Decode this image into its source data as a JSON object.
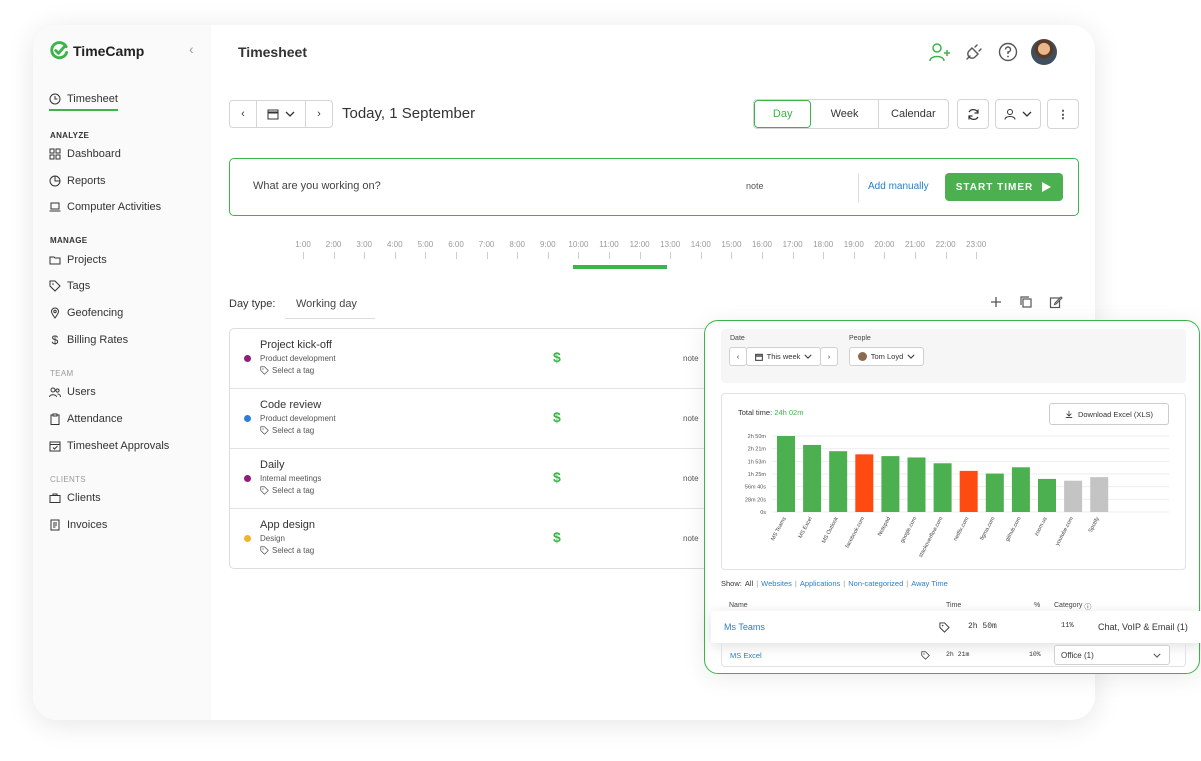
{
  "app": {
    "name": "TimeCamp",
    "page_title": "Timesheet"
  },
  "sidebar": {
    "timesheet": "Timesheet",
    "sections": {
      "analyze": "ANALYZE",
      "manage": "MANAGE",
      "team": "TEAM",
      "clients": "CLIENTS"
    },
    "items": {
      "dashboard": "Dashboard",
      "reports": "Reports",
      "computer_activities": "Computer Activities",
      "projects": "Projects",
      "tags": "Tags",
      "geofencing": "Geofencing",
      "billing_rates": "Billing Rates",
      "users": "Users",
      "attendance": "Attendance",
      "timesheet_approvals": "Timesheet Approvals",
      "clients": "Clients",
      "invoices": "Invoices"
    }
  },
  "toolbar": {
    "date_label": "Today, 1 September",
    "views": [
      "Day",
      "Week",
      "Calendar"
    ],
    "selected_view": "Day"
  },
  "timer": {
    "placeholder": "What are you working on?",
    "note": "note",
    "add_manually": "Add manually",
    "start": "START TIMER"
  },
  "hours": [
    "1:00",
    "2:00",
    "3:00",
    "4:00",
    "5:00",
    "6:00",
    "7:00",
    "8:00",
    "9:00",
    "10:00",
    "11:00",
    "12:00",
    "13:00",
    "14:00",
    "15:00",
    "16:00",
    "17:00",
    "18:00",
    "19:00",
    "20:00",
    "21:00",
    "22:00",
    "23:00"
  ],
  "day_type": {
    "label": "Day type:",
    "value": "Working day"
  },
  "entries": [
    {
      "name": "Project kick-off",
      "project": "Product development",
      "tag": "Select a tag",
      "note": "note",
      "color": "#8e1e7a"
    },
    {
      "name": "Code review",
      "project": "Product development",
      "tag": "Select a tag",
      "note": "note",
      "color": "#2d7fd3"
    },
    {
      "name": "Daily",
      "project": "Internal meetings",
      "tag": "Select a tag",
      "note": "note",
      "color": "#8e1e7a"
    },
    {
      "name": "App design",
      "project": "Design",
      "tag": "Select a tag",
      "note": "note",
      "color": "#f0b429"
    }
  ],
  "report": {
    "date_label": "Date",
    "date_value": "This week",
    "people_label": "People",
    "people_value": "Tom Loyd",
    "total_label": "Total time:",
    "total_value": "24h 02m",
    "download": "Download Excel (XLS)",
    "show_label": "Show:",
    "show_options": [
      "All",
      "Websites",
      "Applications",
      "Non-categorized",
      "Away Time"
    ],
    "columns": {
      "name": "Name",
      "time": "Time",
      "pct": "%",
      "category": "Category"
    },
    "rows": [
      {
        "name": "Ms Teams",
        "time": "2h 50m",
        "pct": "11%",
        "category": "Chat, VoIP & Email (1)"
      },
      {
        "name": "MS Excel",
        "time": "2h 21m",
        "pct": "10%",
        "category": "Office (1)"
      }
    ]
  },
  "chart_data": {
    "type": "bar",
    "y_ticks": [
      "0s",
      "28m 20s",
      "56m 40s",
      "1h 25m",
      "1h 53m",
      "2h 21m",
      "2h 50m"
    ],
    "categories": [
      "MS Teams",
      "MS Excel",
      "MS Outlook",
      "facebook.com",
      "Notepad",
      "google.com",
      "stackoverflow.com",
      "netflix.com",
      "figma.com",
      "github.com",
      "zoom.us",
      "youtube.com",
      "Spotify"
    ],
    "values_minutes": [
      170,
      150,
      136,
      129,
      125,
      122,
      109,
      92,
      86,
      100,
      74,
      70,
      78
    ],
    "colors": [
      "#4caf50",
      "#4caf50",
      "#4caf50",
      "#ff4a12",
      "#4caf50",
      "#4caf50",
      "#4caf50",
      "#ff4a12",
      "#4caf50",
      "#4caf50",
      "#4caf50",
      "#c4c4c4",
      "#c4c4c4"
    ],
    "ylim": [
      0,
      170
    ]
  }
}
